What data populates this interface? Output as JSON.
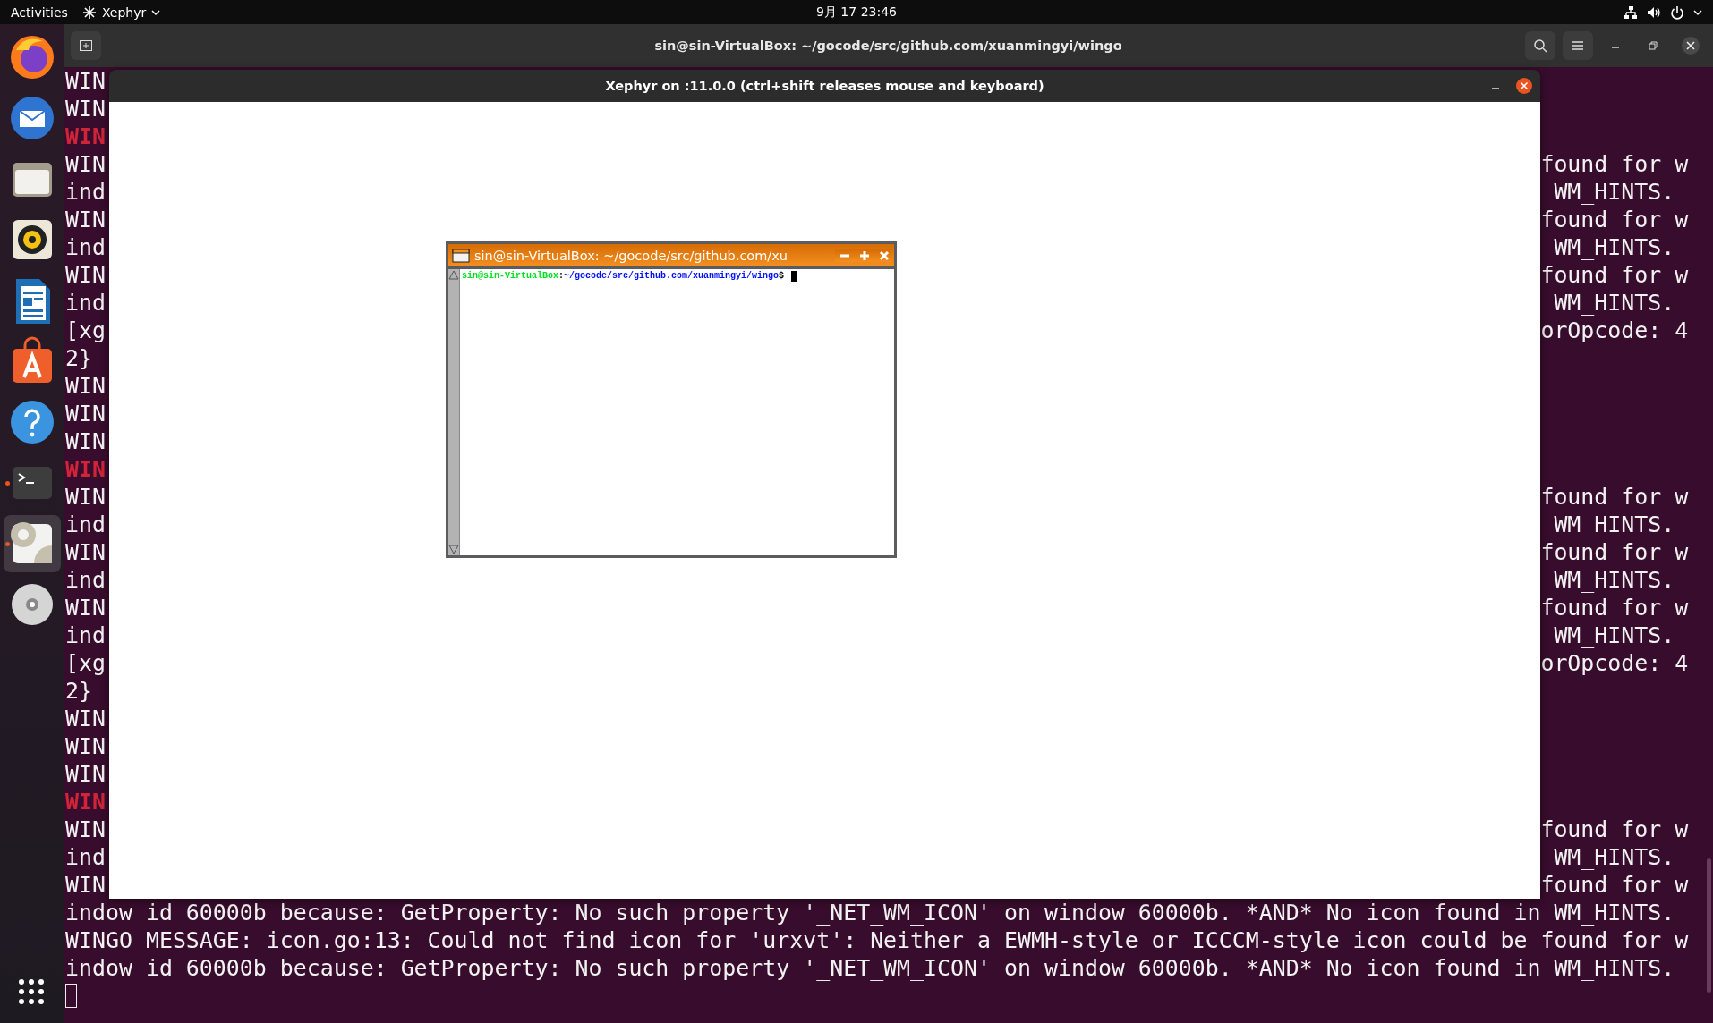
{
  "top_bar": {
    "activities": "Activities",
    "app_menu": "Xephyr",
    "clock": "9月 17  23:46"
  },
  "dock": {
    "items": [
      {
        "kind": "firefox",
        "running": false,
        "selected": false
      },
      {
        "kind": "mail",
        "running": false,
        "selected": false
      },
      {
        "kind": "files",
        "running": false,
        "selected": false
      },
      {
        "kind": "music",
        "running": false,
        "selected": false
      },
      {
        "kind": "writer",
        "running": false,
        "selected": false
      },
      {
        "kind": "software",
        "running": false,
        "selected": false
      },
      {
        "kind": "help",
        "running": false,
        "selected": false
      },
      {
        "kind": "terminal",
        "running": true,
        "selected": false
      },
      {
        "kind": "settings",
        "running": true,
        "selected": true
      },
      {
        "kind": "disc",
        "running": false,
        "selected": false
      }
    ]
  },
  "terminal": {
    "title": "sin@sin-VirtualBox: ~/gocode/src/github.com/xuanmingyi/wingo",
    "lines": [
      {
        "kind": "clipped",
        "left": "WIN",
        "error": false
      },
      {
        "kind": "clipped",
        "left": "WIN",
        "error": false
      },
      {
        "kind": "clipped",
        "left": "WIN",
        "error": true
      },
      {
        "kind": "clipped",
        "left": "WIN",
        "right": "found for w",
        "error": false
      },
      {
        "kind": "clipped",
        "left": "ind",
        "right": " WM_HINTS.",
        "error": false
      },
      {
        "kind": "clipped",
        "left": "WIN",
        "right": "found for w",
        "error": false
      },
      {
        "kind": "clipped",
        "left": "ind",
        "right": " WM_HINTS.",
        "error": false
      },
      {
        "kind": "clipped",
        "left": "WIN",
        "right": "found for w",
        "error": false
      },
      {
        "kind": "clipped",
        "left": "ind",
        "right": " WM_HINTS.",
        "error": false
      },
      {
        "kind": "clipped",
        "left": "[xg",
        "right": "orOpcode: 4",
        "error": false
      },
      {
        "kind": "clipped",
        "left": "2}",
        "error": false
      },
      {
        "kind": "clipped",
        "left": "WIN",
        "error": false
      },
      {
        "kind": "clipped",
        "left": "WIN",
        "error": false
      },
      {
        "kind": "clipped",
        "left": "WIN",
        "error": false
      },
      {
        "kind": "clipped",
        "left": "WIN",
        "error": true
      },
      {
        "kind": "clipped",
        "left": "WIN",
        "right": "found for w",
        "error": false
      },
      {
        "kind": "clipped",
        "left": "ind",
        "right": " WM_HINTS.",
        "error": false
      },
      {
        "kind": "clipped",
        "left": "WIN",
        "right": "found for w",
        "error": false
      },
      {
        "kind": "clipped",
        "left": "ind",
        "right": " WM_HINTS.",
        "error": false
      },
      {
        "kind": "clipped",
        "left": "WIN",
        "right": "found for w",
        "error": false
      },
      {
        "kind": "clipped",
        "left": "ind",
        "right": " WM_HINTS.",
        "error": false
      },
      {
        "kind": "clipped",
        "left": "[xg",
        "right": "orOpcode: 4",
        "error": false
      },
      {
        "kind": "clipped",
        "left": "2}",
        "error": false
      },
      {
        "kind": "clipped",
        "left": "WIN",
        "error": false
      },
      {
        "kind": "clipped",
        "left": "WIN",
        "error": false
      },
      {
        "kind": "clipped",
        "left": "WIN",
        "error": false
      },
      {
        "kind": "clipped",
        "left": "WIN",
        "error": true
      },
      {
        "kind": "clipped",
        "left": "WIN",
        "right": "found for w",
        "error": false
      },
      {
        "kind": "clipped",
        "left": "ind",
        "right": " WM_HINTS.",
        "error": false
      },
      {
        "kind": "clipped",
        "left": "WIN",
        "right": "found for w",
        "error": false
      },
      {
        "kind": "full",
        "text": "indow id 60000b because: GetProperty: No such property '_NET_WM_ICON' on window 60000b. *AND* No icon found in WM_HINTS."
      },
      {
        "kind": "full",
        "text": "WINGO MESSAGE: icon.go:13: Could not find icon for 'urxvt': Neither a EWMH-style or ICCCM-style icon could be found for w"
      },
      {
        "kind": "full",
        "text": "indow id 60000b because: GetProperty: No such property '_NET_WM_ICON' on window 60000b. *AND* No icon found in WM_HINTS."
      },
      {
        "kind": "cursor"
      }
    ]
  },
  "xephyr_window": {
    "title": "Xephyr on :11.0.0 (ctrl+shift releases mouse and keyboard)",
    "urxvt_window": {
      "title": "sin@sin-VirtualBox: ~/gocode/src/github.com/xu",
      "prompt": {
        "user_host": "sin@sin-VirtualBox",
        "separator": ":",
        "path": "~/gocode/src/github.com/xuanmingyi/wingo",
        "symbol": "$"
      }
    }
  }
}
